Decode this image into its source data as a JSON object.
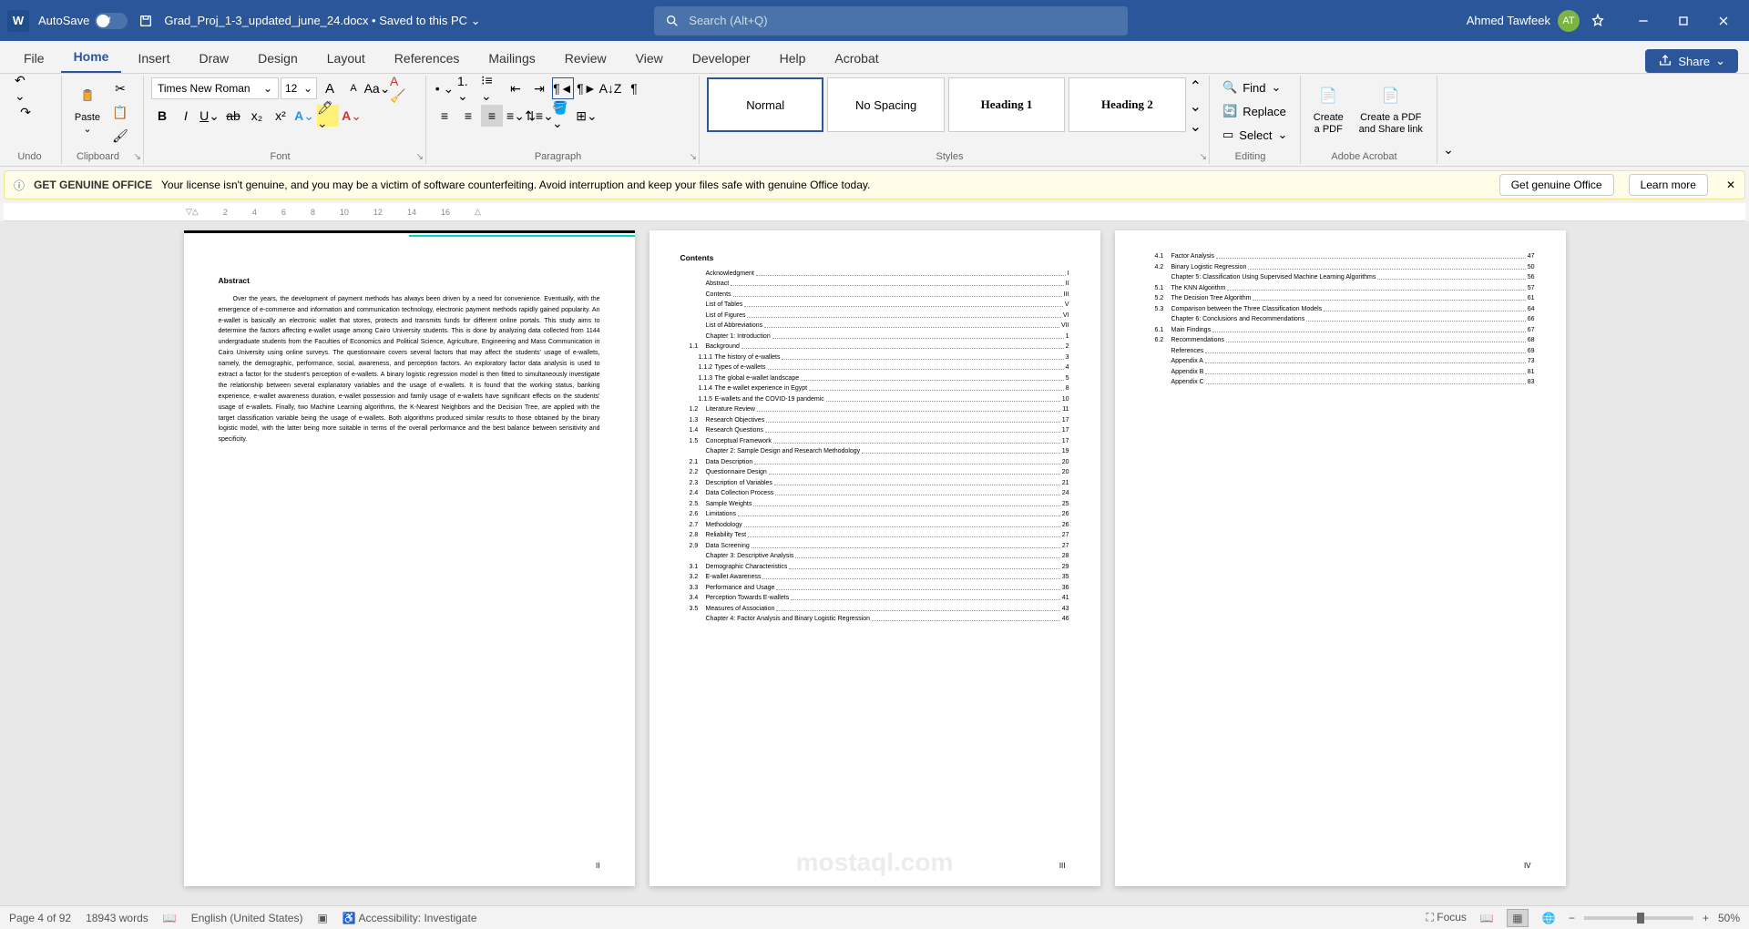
{
  "titlebar": {
    "app_letter": "W",
    "autosave_label": "AutoSave",
    "autosave_state": "Off",
    "filename": "Grad_Proj_1-3_updated_june_24.docx",
    "save_status": "Saved to this PC",
    "search_placeholder": "Search (Alt+Q)",
    "user_name": "Ahmed Tawfeek",
    "user_initials": "AT"
  },
  "tabs": {
    "file": "File",
    "home": "Home",
    "insert": "Insert",
    "draw": "Draw",
    "design": "Design",
    "layout": "Layout",
    "references": "References",
    "mailings": "Mailings",
    "review": "Review",
    "view": "View",
    "developer": "Developer",
    "help": "Help",
    "acrobat": "Acrobat",
    "share": "Share"
  },
  "ribbon": {
    "undo_group": "Undo",
    "clipboard_group": "Clipboard",
    "paste_label": "Paste",
    "font_group": "Font",
    "font_name": "Times New Roman",
    "font_size": "12",
    "paragraph_group": "Paragraph",
    "styles_group": "Styles",
    "style_normal": "Normal",
    "style_nospacing": "No Spacing",
    "style_h1": "Heading 1",
    "style_h2": "Heading 2",
    "editing_group": "Editing",
    "find": "Find",
    "replace": "Replace",
    "select": "Select",
    "acrobat_group": "Adobe Acrobat",
    "create_pdf": "Create a PDF",
    "share_pdf": "Create a PDF and Share link"
  },
  "notice": {
    "title": "GET GENUINE OFFICE",
    "text": "Your license isn't genuine, and you may be a victim of software counterfeiting. Avoid interruption and keep your files safe with genuine Office today.",
    "btn1": "Get genuine Office",
    "btn2": "Learn more"
  },
  "ruler": [
    "2",
    "4",
    "6",
    "8",
    "10",
    "12",
    "14",
    "16"
  ],
  "abstract": {
    "title": "Abstract",
    "body": "Over the years, the development of payment methods has always been driven by a need for convenience. Eventually, with the emergence of e-commerce and information and communication technology, electronic payment methods rapidly gained popularity. An e-wallet is basically an electronic wallet that stores, protects and transmits funds for different online portals. This study aims to determine the factors affecting e-wallet usage among Cairo University students. This is done by analyzing data collected from 1144 undergraduate students from the Faculties of Economics and Political Science, Agriculture, Engineering and Mass Communication in Cairo University using online surveys. The questionnaire covers several factors that may affect the students' usage of e-wallets, namely, the demographic, performance, social, awareness, and perception factors. An exploratory factor data analysis is used to extract a factor for the student's perception of e-wallets. A binary logistic regression model is then fitted to simultaneously investigate the relationship between several explanatory variables and the usage of e-wallets. It is found that the working status, banking experience, e-wallet awareness duration, e-wallet possession and family usage of e-wallets have significant effects on the students' usage of e-wallets. Finally, two Machine Learning algorithms, the K-Nearest Neighbors and the Decision Tree, are applied with the target classification variable being the usage of e-wallets. Both algorithms produced similar results to those obtained by the binary logistic model, with the latter being more suitable in terms of the overall performance and the best balance between sensitivity and specificity.",
    "page_num": "II"
  },
  "toc": {
    "title": "Contents",
    "page_num": "III",
    "items": [
      {
        "n": "",
        "t": "Acknowledgment",
        "p": "I"
      },
      {
        "n": "",
        "t": "Abstract",
        "p": "II"
      },
      {
        "n": "",
        "t": "Contents",
        "p": "III"
      },
      {
        "n": "",
        "t": "List of Tables",
        "p": "V"
      },
      {
        "n": "",
        "t": "List of Figures",
        "p": "VI"
      },
      {
        "n": "",
        "t": "List of Abbreviations",
        "p": "VII"
      },
      {
        "n": "",
        "t": "Chapter 1: Introduction",
        "p": "1"
      },
      {
        "n": "1.1",
        "l": 2,
        "t": "Background",
        "p": "2"
      },
      {
        "n": "1.1.1",
        "l": 3,
        "t": "The history of e-wallets",
        "p": "3"
      },
      {
        "n": "1.1.2",
        "l": 3,
        "t": "Types of e-wallets",
        "p": "4"
      },
      {
        "n": "1.1.3",
        "l": 3,
        "t": "The global e-wallet landscape",
        "p": "5"
      },
      {
        "n": "1.1.4",
        "l": 3,
        "t": "The e-wallet experience in Egypt",
        "p": "8"
      },
      {
        "n": "1.1.5",
        "l": 3,
        "t": "E-wallets and the COVID-19 pandemic",
        "p": "10"
      },
      {
        "n": "1.2",
        "l": 2,
        "t": "Literature Review",
        "p": "11"
      },
      {
        "n": "1.3",
        "l": 2,
        "t": "Research Objectives",
        "p": "17"
      },
      {
        "n": "1.4",
        "l": 2,
        "t": "Research Questions",
        "p": "17"
      },
      {
        "n": "1.5",
        "l": 2,
        "t": "Conceptual Framework",
        "p": "17"
      },
      {
        "n": "",
        "t": "Chapter 2: Sample Design and Research Methodology",
        "p": "19"
      },
      {
        "n": "2.1",
        "l": 2,
        "t": "Data Description",
        "p": "20"
      },
      {
        "n": "2.2",
        "l": 2,
        "t": "Questionnaire Design",
        "p": "20"
      },
      {
        "n": "2.3",
        "l": 2,
        "t": "Description of Variables",
        "p": "21"
      },
      {
        "n": "2.4",
        "l": 2,
        "t": "Data Collection Process",
        "p": "24"
      },
      {
        "n": "2.5",
        "l": 2,
        "t": "Sample Weights",
        "p": "25"
      },
      {
        "n": "2.6",
        "l": 2,
        "t": "Limitations",
        "p": "26"
      },
      {
        "n": "2.7",
        "l": 2,
        "t": "Methodology",
        "p": "26"
      },
      {
        "n": "2.8",
        "l": 2,
        "t": "Reliability Test",
        "p": "27"
      },
      {
        "n": "2.9",
        "l": 2,
        "t": "Data Screening",
        "p": "27"
      },
      {
        "n": "",
        "t": "Chapter 3: Descriptive Analysis",
        "p": "28"
      },
      {
        "n": "3.1",
        "l": 2,
        "t": "Demographic Characteristics",
        "p": "29"
      },
      {
        "n": "3.2",
        "l": 2,
        "t": "E-wallet Awareness",
        "p": "35"
      },
      {
        "n": "3.3",
        "l": 2,
        "t": "Performance and Usage",
        "p": "36"
      },
      {
        "n": "3.4",
        "l": 2,
        "t": "Perception Towards E-wallets",
        "p": "41"
      },
      {
        "n": "3.5",
        "l": 2,
        "t": "Measures of Association",
        "p": "43"
      },
      {
        "n": "",
        "t": "Chapter 4: Factor Analysis and Binary Logistic Regression",
        "p": "46"
      }
    ]
  },
  "toc2": {
    "page_num": "IV",
    "items": [
      {
        "n": "4.1",
        "l": 2,
        "t": "Factor Analysis",
        "p": "47"
      },
      {
        "n": "4.2",
        "l": 2,
        "t": "Binary Logistic Regression",
        "p": "50"
      },
      {
        "n": "",
        "t": "Chapter 5: Classification Using Supervised Machine Learning Algorithms",
        "p": "56"
      },
      {
        "n": "5.1",
        "l": 2,
        "t": "The KNN Algorithm",
        "p": "57"
      },
      {
        "n": "5.2",
        "l": 2,
        "t": "The Decision Tree Algorithm",
        "p": "61"
      },
      {
        "n": "5.3",
        "l": 2,
        "t": "Comparison between the Three Classification Models",
        "p": "64"
      },
      {
        "n": "",
        "t": "Chapter 6: Conclusions and Recommendations",
        "p": "66"
      },
      {
        "n": "6.1",
        "l": 2,
        "t": "Main Findings",
        "p": "67"
      },
      {
        "n": "6.2",
        "l": 2,
        "t": "Recommendations",
        "p": "68"
      },
      {
        "n": "",
        "t": "References",
        "p": "69"
      },
      {
        "n": "",
        "t": "Appendix A",
        "p": "73"
      },
      {
        "n": "",
        "t": "Appendix B",
        "p": "81"
      },
      {
        "n": "",
        "t": "Appendix C",
        "p": "83"
      }
    ]
  },
  "status": {
    "page": "Page 4 of 92",
    "words": "18943 words",
    "lang": "English (United States)",
    "accessibility": "Accessibility: Investigate",
    "focus": "Focus",
    "zoom": "50%"
  },
  "watermark": "mostaql.com"
}
